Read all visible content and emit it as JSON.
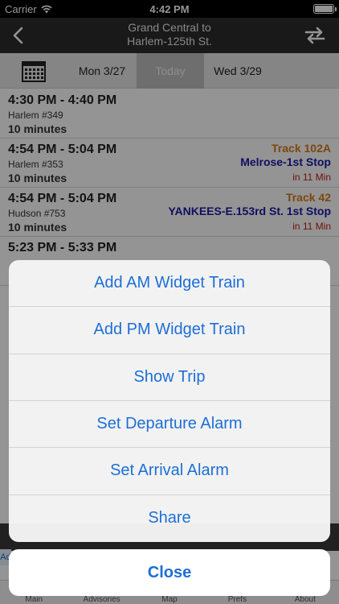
{
  "status_bar": {
    "carrier": "Carrier",
    "time": "4:42 PM"
  },
  "nav": {
    "title_line1": "Grand Central to",
    "title_line2": "Harlem-125th St."
  },
  "date_bar": {
    "prev_day": "Mon 3/27",
    "current_day": "Today",
    "next_day": "Wed 3/29"
  },
  "trains": [
    {
      "times": "4:30 PM - 4:40 PM",
      "train": "Harlem #349",
      "duration": "10 minutes",
      "track": "",
      "stop": "",
      "eta": ""
    },
    {
      "times": "4:54 PM - 5:04 PM",
      "train": "Harlem #353",
      "duration": "10 minutes",
      "track": "Track 102A",
      "stop": "Melrose-1st Stop",
      "eta": "in 11 Min"
    },
    {
      "times": "4:54 PM - 5:04 PM",
      "train": "Hudson #753",
      "duration": "10 minutes",
      "track": "Track 42",
      "stop": "YANKEES-E.153rd St. 1st Stop",
      "eta": "in 11 Min"
    },
    {
      "times": "5:23 PM - 5:33 PM",
      "train": "",
      "duration": "",
      "track": "",
      "stop": "",
      "eta": ""
    }
  ],
  "ad": {
    "label": "Ad"
  },
  "tabs": [
    "Main",
    "Advisories",
    "Map",
    "Prefs",
    "About"
  ],
  "action_sheet": {
    "actions": [
      "Add AM Widget Train",
      "Add PM Widget Train",
      "Show Trip",
      "Set Departure Alarm",
      "Set Arrival Alarm",
      "Share"
    ],
    "cancel": "Close"
  },
  "colors": {
    "accent": "#1d6fd6",
    "track": "#d77a1a",
    "stop": "#1a1aa6",
    "eta": "#c41a1a",
    "nav_bg": "#2b2b2b"
  }
}
